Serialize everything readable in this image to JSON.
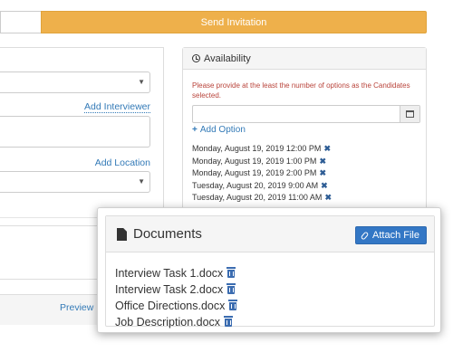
{
  "toolbar": {
    "send_label": "Send Invitation"
  },
  "left_form": {
    "add_interviewer_label": "Add Interviewer",
    "add_location_label": "Add Location",
    "preview_label": "Preview E"
  },
  "availability": {
    "title": "Availability",
    "message": "Please provide at the least the number of options as the Candidates selected.",
    "add_option_label": "Add Option",
    "slots": [
      "Monday, August 19, 2019 12:00 PM",
      "Monday, August 19, 2019 1:00 PM",
      "Monday, August 19, 2019 2:00 PM",
      "Tuesday, August 20, 2019 9:00 AM",
      "Tuesday, August 20, 2019 11:00 AM"
    ]
  },
  "documents": {
    "title": "Documents",
    "attach_label": "Attach File",
    "files": [
      "Interview Task 1.docx",
      "Interview Task 2.docx",
      "Office Directions.docx",
      "Job Description.docx"
    ]
  },
  "colors": {
    "send_button": "#eeb04b",
    "link": "#337ab7",
    "warning_text": "#b9443b",
    "attach_button": "#3377c5"
  }
}
